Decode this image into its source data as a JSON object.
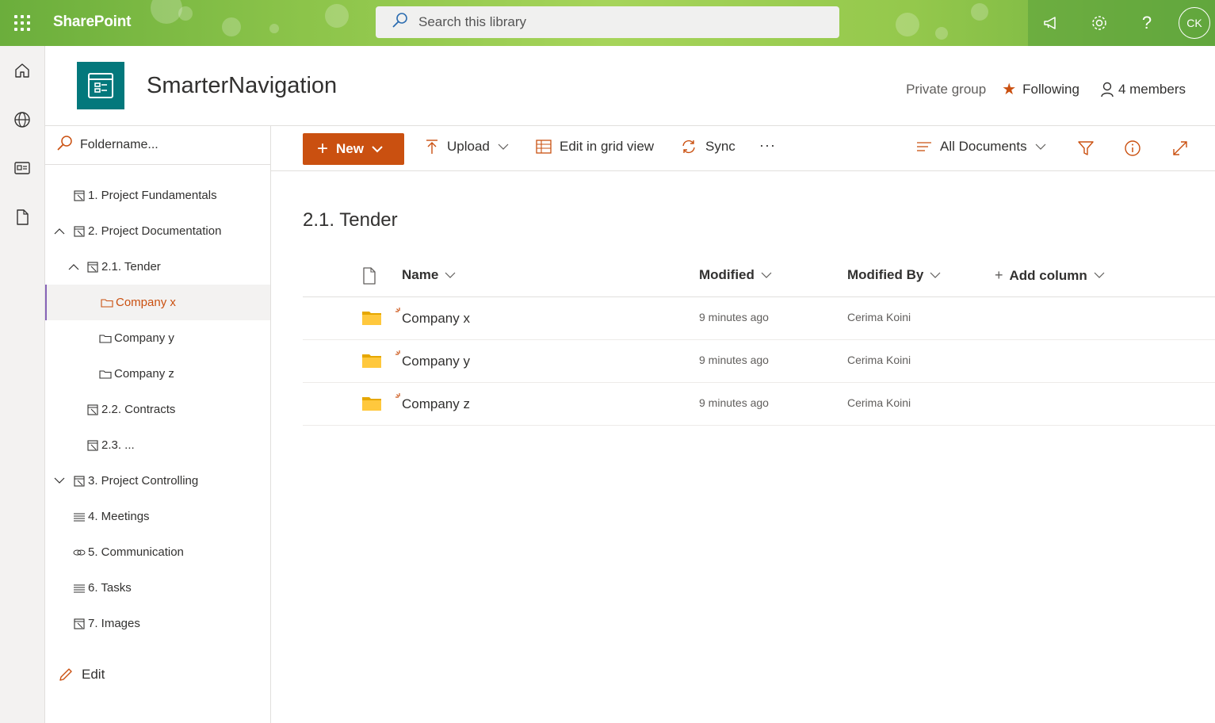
{
  "suite": {
    "brand": "SharePoint",
    "search_placeholder": "Search this library",
    "avatar_initials": "CK"
  },
  "site": {
    "title": "SmarterNavigation",
    "privacy": "Private group",
    "following": "Following",
    "members": "4 members"
  },
  "nav": {
    "search_placeholder": "Foldername...",
    "items": [
      {
        "label": "1. Project Fundamentals"
      },
      {
        "label": "2. Project Documentation"
      },
      {
        "label": "2.1. Tender"
      },
      {
        "label": "Company x"
      },
      {
        "label": "Company y"
      },
      {
        "label": "Company z"
      },
      {
        "label": "2.2. Contracts"
      },
      {
        "label": "2.3. ..."
      },
      {
        "label": "3. Project Controlling"
      },
      {
        "label": "4. Meetings"
      },
      {
        "label": "5. Communication"
      },
      {
        "label": "6. Tasks"
      },
      {
        "label": "7. Images"
      }
    ],
    "edit_label": "Edit"
  },
  "commandbar": {
    "new_label": "New",
    "upload_label": "Upload",
    "grid_label": "Edit in grid view",
    "sync_label": "Sync",
    "more_label": "···",
    "view_label": "All Documents"
  },
  "library": {
    "title": "2.1. Tender",
    "columns": {
      "name": "Name",
      "modified": "Modified",
      "modified_by": "Modified By",
      "add_column": "Add column"
    },
    "rows": [
      {
        "name": "Company x",
        "modified": "9 minutes ago",
        "modified_by": "Cerima Koini"
      },
      {
        "name": "Company y",
        "modified": "9 minutes ago",
        "modified_by": "Cerima Koini"
      },
      {
        "name": "Company z",
        "modified": "9 minutes ago",
        "modified_by": "Cerima Koini"
      }
    ]
  },
  "colors": {
    "accent": "#ca5010",
    "site_logo": "#03787c",
    "suite_green": "#8cc44a",
    "selected_border": "#8764b8"
  }
}
